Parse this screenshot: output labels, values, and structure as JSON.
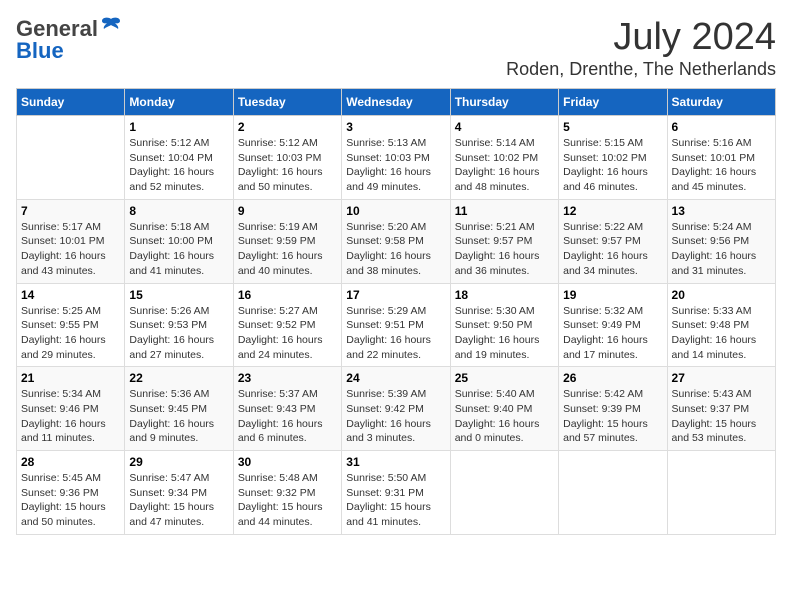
{
  "header": {
    "logo_general": "General",
    "logo_blue": "Blue",
    "month_year": "July 2024",
    "location": "Roden, Drenthe, The Netherlands"
  },
  "calendar": {
    "days_of_week": [
      "Sunday",
      "Monday",
      "Tuesday",
      "Wednesday",
      "Thursday",
      "Friday",
      "Saturday"
    ],
    "weeks": [
      [
        {
          "day": "",
          "info": ""
        },
        {
          "day": "1",
          "info": "Sunrise: 5:12 AM\nSunset: 10:04 PM\nDaylight: 16 hours\nand 52 minutes."
        },
        {
          "day": "2",
          "info": "Sunrise: 5:12 AM\nSunset: 10:03 PM\nDaylight: 16 hours\nand 50 minutes."
        },
        {
          "day": "3",
          "info": "Sunrise: 5:13 AM\nSunset: 10:03 PM\nDaylight: 16 hours\nand 49 minutes."
        },
        {
          "day": "4",
          "info": "Sunrise: 5:14 AM\nSunset: 10:02 PM\nDaylight: 16 hours\nand 48 minutes."
        },
        {
          "day": "5",
          "info": "Sunrise: 5:15 AM\nSunset: 10:02 PM\nDaylight: 16 hours\nand 46 minutes."
        },
        {
          "day": "6",
          "info": "Sunrise: 5:16 AM\nSunset: 10:01 PM\nDaylight: 16 hours\nand 45 minutes."
        }
      ],
      [
        {
          "day": "7",
          "info": "Sunrise: 5:17 AM\nSunset: 10:01 PM\nDaylight: 16 hours\nand 43 minutes."
        },
        {
          "day": "8",
          "info": "Sunrise: 5:18 AM\nSunset: 10:00 PM\nDaylight: 16 hours\nand 41 minutes."
        },
        {
          "day": "9",
          "info": "Sunrise: 5:19 AM\nSunset: 9:59 PM\nDaylight: 16 hours\nand 40 minutes."
        },
        {
          "day": "10",
          "info": "Sunrise: 5:20 AM\nSunset: 9:58 PM\nDaylight: 16 hours\nand 38 minutes."
        },
        {
          "day": "11",
          "info": "Sunrise: 5:21 AM\nSunset: 9:57 PM\nDaylight: 16 hours\nand 36 minutes."
        },
        {
          "day": "12",
          "info": "Sunrise: 5:22 AM\nSunset: 9:57 PM\nDaylight: 16 hours\nand 34 minutes."
        },
        {
          "day": "13",
          "info": "Sunrise: 5:24 AM\nSunset: 9:56 PM\nDaylight: 16 hours\nand 31 minutes."
        }
      ],
      [
        {
          "day": "14",
          "info": "Sunrise: 5:25 AM\nSunset: 9:55 PM\nDaylight: 16 hours\nand 29 minutes."
        },
        {
          "day": "15",
          "info": "Sunrise: 5:26 AM\nSunset: 9:53 PM\nDaylight: 16 hours\nand 27 minutes."
        },
        {
          "day": "16",
          "info": "Sunrise: 5:27 AM\nSunset: 9:52 PM\nDaylight: 16 hours\nand 24 minutes."
        },
        {
          "day": "17",
          "info": "Sunrise: 5:29 AM\nSunset: 9:51 PM\nDaylight: 16 hours\nand 22 minutes."
        },
        {
          "day": "18",
          "info": "Sunrise: 5:30 AM\nSunset: 9:50 PM\nDaylight: 16 hours\nand 19 minutes."
        },
        {
          "day": "19",
          "info": "Sunrise: 5:32 AM\nSunset: 9:49 PM\nDaylight: 16 hours\nand 17 minutes."
        },
        {
          "day": "20",
          "info": "Sunrise: 5:33 AM\nSunset: 9:48 PM\nDaylight: 16 hours\nand 14 minutes."
        }
      ],
      [
        {
          "day": "21",
          "info": "Sunrise: 5:34 AM\nSunset: 9:46 PM\nDaylight: 16 hours\nand 11 minutes."
        },
        {
          "day": "22",
          "info": "Sunrise: 5:36 AM\nSunset: 9:45 PM\nDaylight: 16 hours\nand 9 minutes."
        },
        {
          "day": "23",
          "info": "Sunrise: 5:37 AM\nSunset: 9:43 PM\nDaylight: 16 hours\nand 6 minutes."
        },
        {
          "day": "24",
          "info": "Sunrise: 5:39 AM\nSunset: 9:42 PM\nDaylight: 16 hours\nand 3 minutes."
        },
        {
          "day": "25",
          "info": "Sunrise: 5:40 AM\nSunset: 9:40 PM\nDaylight: 16 hours\nand 0 minutes."
        },
        {
          "day": "26",
          "info": "Sunrise: 5:42 AM\nSunset: 9:39 PM\nDaylight: 15 hours\nand 57 minutes."
        },
        {
          "day": "27",
          "info": "Sunrise: 5:43 AM\nSunset: 9:37 PM\nDaylight: 15 hours\nand 53 minutes."
        }
      ],
      [
        {
          "day": "28",
          "info": "Sunrise: 5:45 AM\nSunset: 9:36 PM\nDaylight: 15 hours\nand 50 minutes."
        },
        {
          "day": "29",
          "info": "Sunrise: 5:47 AM\nSunset: 9:34 PM\nDaylight: 15 hours\nand 47 minutes."
        },
        {
          "day": "30",
          "info": "Sunrise: 5:48 AM\nSunset: 9:32 PM\nDaylight: 15 hours\nand 44 minutes."
        },
        {
          "day": "31",
          "info": "Sunrise: 5:50 AM\nSunset: 9:31 PM\nDaylight: 15 hours\nand 41 minutes."
        },
        {
          "day": "",
          "info": ""
        },
        {
          "day": "",
          "info": ""
        },
        {
          "day": "",
          "info": ""
        }
      ]
    ]
  }
}
